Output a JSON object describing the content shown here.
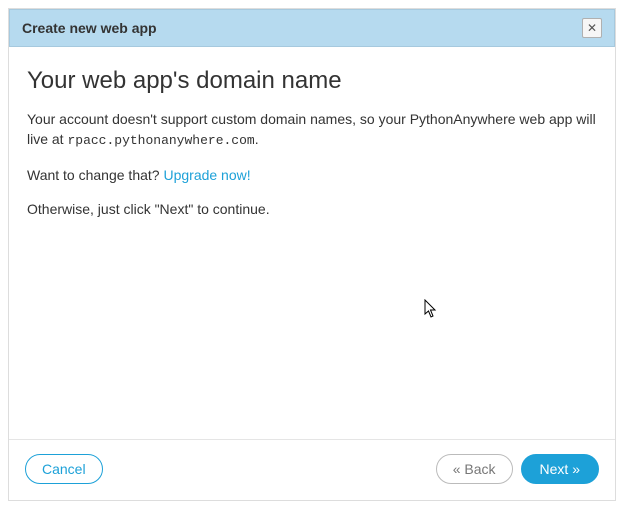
{
  "dialog": {
    "title": "Create new web app",
    "heading": "Your web app's domain name",
    "intro_before": "Your account doesn't support custom domain names, so your PythonAnywhere web app will live at ",
    "domain": "rpacc.pythonanywhere.com",
    "intro_after": ".",
    "change_prompt": "Want to change that? ",
    "upgrade_link": "Upgrade now!",
    "otherwise": "Otherwise, just click \"Next\" to continue."
  },
  "footer": {
    "cancel": "Cancel",
    "back": "« Back",
    "next": "Next »"
  },
  "icons": {
    "close": "✕"
  }
}
